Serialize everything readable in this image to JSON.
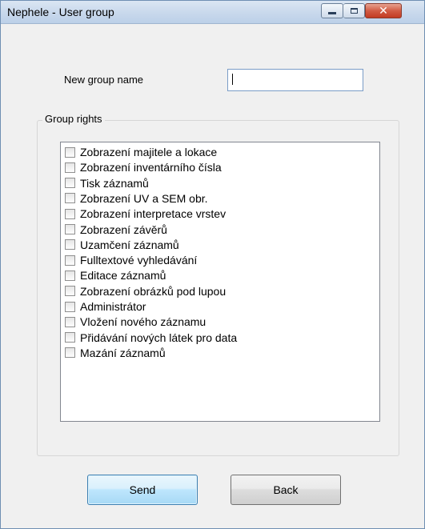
{
  "window": {
    "title": "Nephele - User group"
  },
  "form": {
    "group_name_label": "New group name",
    "group_name_value": "",
    "group_rights_label": "Group rights"
  },
  "rights": [
    {
      "label": "Zobrazení majitele a lokace",
      "checked": false
    },
    {
      "label": "Zobrazení inventárního čísla",
      "checked": false
    },
    {
      "label": "Tisk záznamů",
      "checked": false
    },
    {
      "label": "Zobrazení UV a SEM obr.",
      "checked": false
    },
    {
      "label": "Zobrazení interpretace vrstev",
      "checked": false
    },
    {
      "label": "Zobrazení závěrů",
      "checked": false
    },
    {
      "label": "Uzamčení záznamů",
      "checked": false
    },
    {
      "label": "Fulltextové vyhledávání",
      "checked": false
    },
    {
      "label": "Editace záznamů",
      "checked": false
    },
    {
      "label": "Zobrazení obrázků pod lupou",
      "checked": false
    },
    {
      "label": "Administrátor",
      "checked": false
    },
    {
      "label": "Vložení nového záznamu",
      "checked": false
    },
    {
      "label": "Přidávání nových látek pro data",
      "checked": false
    },
    {
      "label": "Mazání záznamů",
      "checked": false
    }
  ],
  "buttons": {
    "send_label": "Send",
    "back_label": "Back"
  }
}
